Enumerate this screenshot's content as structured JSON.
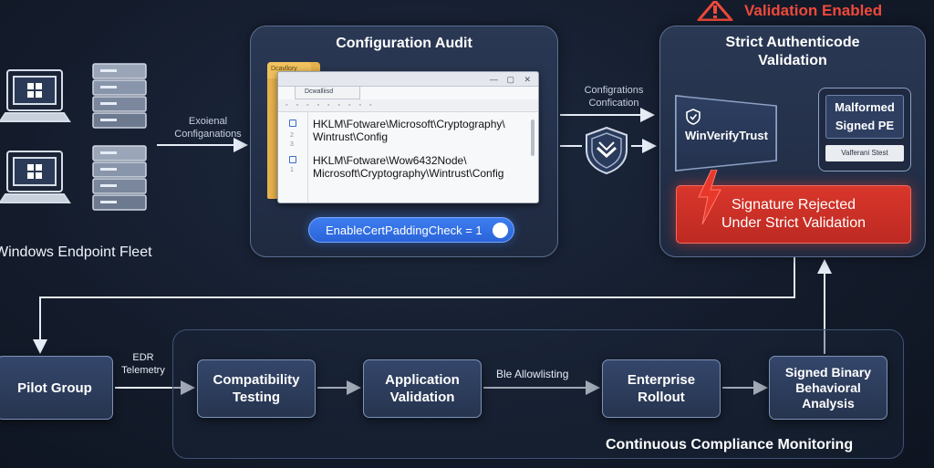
{
  "banner": {
    "text": "Validation Enabled",
    "icon": "warning-triangle-icon"
  },
  "fleet": {
    "label": "Windows Endpoint Fleet"
  },
  "labels": {
    "external_configurations": "Exoienal\nConfiganations",
    "configurations_confirmation": "Configrations\nConfication",
    "edr_telemetry": "EDR\nTelemetry",
    "allowlisting": "Ble Allowlisting"
  },
  "audit": {
    "title": "Configuration Audit",
    "folder_tab": "Dcavllory",
    "window_tab": "Dcwalliisd",
    "registry_paths": [
      "HKLM\\Fotware\\Microsoft\\Cryptography\\\nWintrust\\Config",
      "HKLM\\Fotware\\Wow6432Node\\\nMicrosoft\\Cryptography\\Wintrust\\Config"
    ],
    "toggle_label": "EnableCertPaddingCheck = 1"
  },
  "validation": {
    "title": "Strict Authenticode\nValidation",
    "winverifytrust": "WinVerifyTrust",
    "malformed_line1": "Malformed",
    "malformed_line2": "Signed PE",
    "malformed_tag": "Valferani Stest",
    "rejected": "Signature Rejected\nUnder Strict Validation"
  },
  "pipeline": {
    "stages": [
      "Pilot Group",
      "Compatibility\nTesting",
      "Application\nValidation",
      "Enterprise\nRollout",
      "Signed Binary\nBehavioral\nAnalysis"
    ],
    "monitoring_title": "Continuous Compliance Monitoring"
  },
  "colors": {
    "background": "#141c2c",
    "panel": "#243250",
    "accent_blue": "#2f6fe4",
    "alert_red": "#d3342a",
    "warning_red": "#ef4a3b"
  }
}
